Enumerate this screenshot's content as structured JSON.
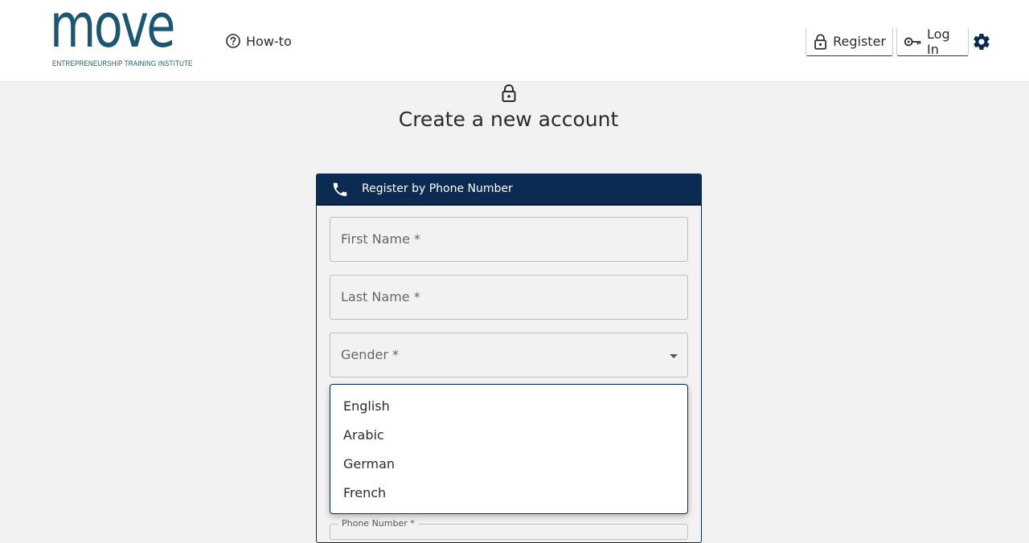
{
  "header": {
    "logo": {
      "word": "move",
      "tagline": "ENTREPRENEURSHIP TRAINING INSTITUTE"
    },
    "howto_label": "How-to",
    "register_label": "Register",
    "login_label": "Log In"
  },
  "main": {
    "title": "Create a new account",
    "card": {
      "header_label": "Register by Phone Number",
      "fields": {
        "first_name": "First Name *",
        "last_name": "Last Name *",
        "gender": "Gender *",
        "phone": "Phone Number *"
      }
    },
    "language_options": [
      "English",
      "Arabic",
      "German",
      "French"
    ]
  },
  "colors": {
    "brand_navy": "#0c2b52",
    "logo_teal": "#1d5670",
    "background": "#f2f2f2"
  }
}
